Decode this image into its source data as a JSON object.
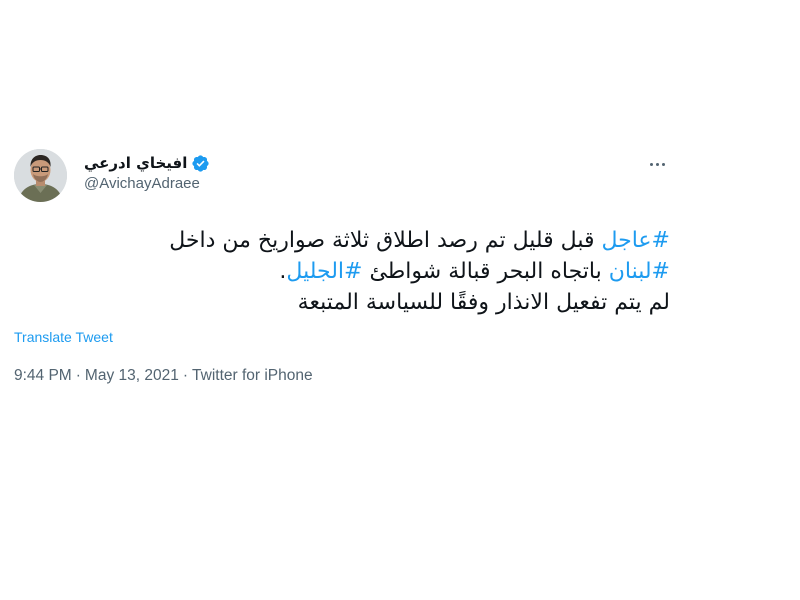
{
  "tweet": {
    "author": {
      "display_name": "افيخاي ادرعي",
      "handle": "@AvichayAdraee",
      "verified_icon": "verified-badge-icon",
      "avatar": "avatar"
    },
    "more_icon": "more-options-icon",
    "body": {
      "line1": {
        "hashtag": "#عاجل",
        "text": " قبل قليل تم رصد اطلاق ثلاثة صواريخ من داخل"
      },
      "line2": {
        "hashtag1": "#لبنان",
        "text": " باتجاه البحر قبالة شواطئ ",
        "hashtag2": "#الجليل",
        "end": "."
      },
      "line3": "لم يتم تفعيل الانذار وفقًا للسياسة المتبعة"
    },
    "translate_label": "Translate Tweet",
    "meta": {
      "time": "9:44 PM",
      "date": "May 13, 2021",
      "source": "Twitter for iPhone",
      "separator": "·"
    }
  },
  "colors": {
    "link": "#1d9bf0",
    "text": "#0f1419",
    "secondary": "#536471"
  }
}
